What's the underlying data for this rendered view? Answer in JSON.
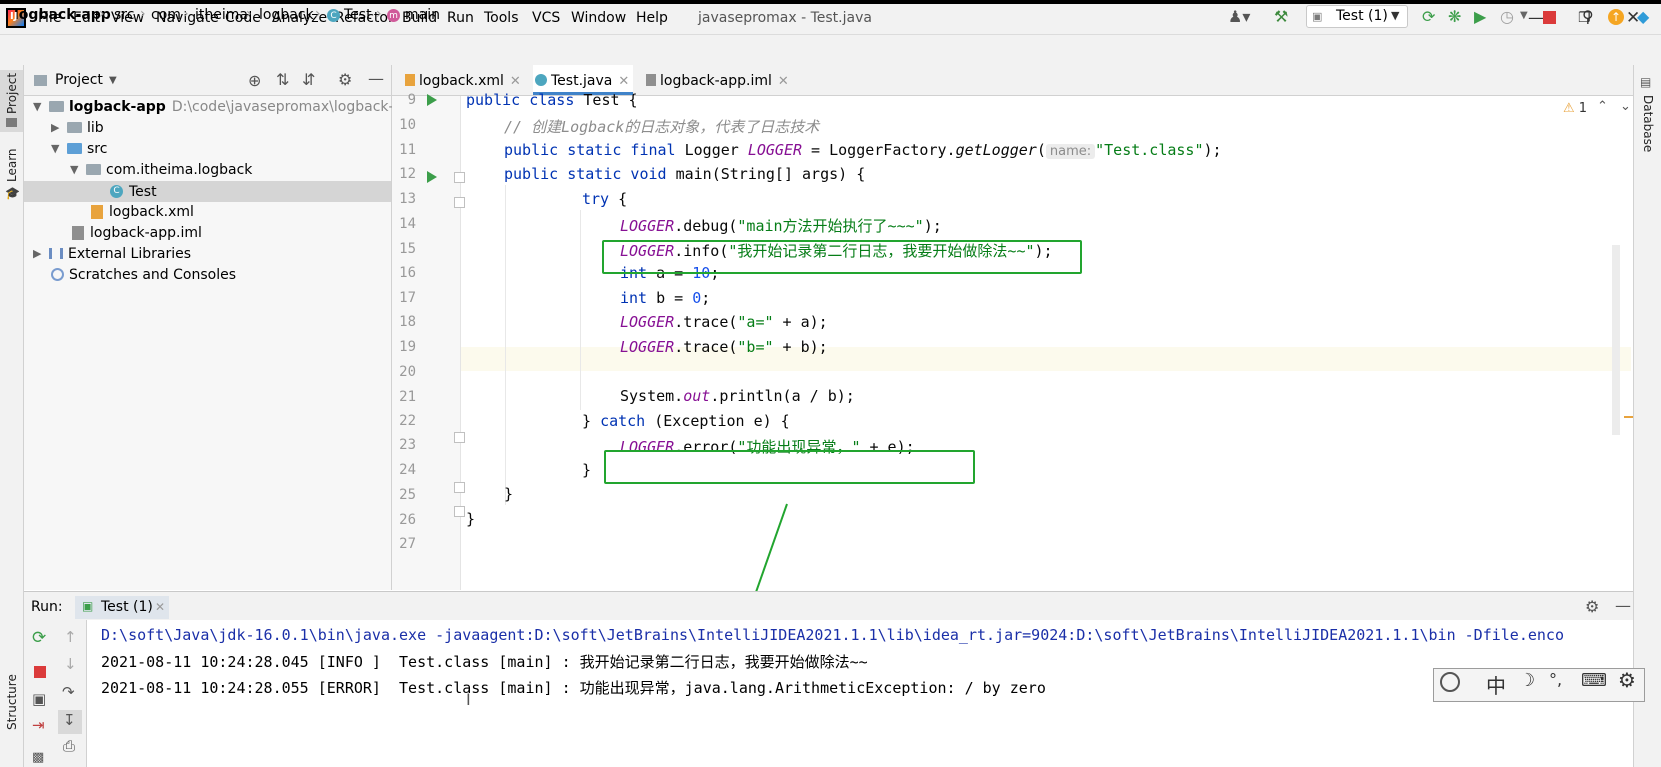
{
  "menubar": {
    "items": [
      "File",
      "Edit",
      "View",
      "Navigate",
      "Code",
      "Analyze",
      "Refactor",
      "Build",
      "Run",
      "Tools",
      "VCS",
      "Window",
      "Help"
    ],
    "window_title": "javasepromax - Test.java"
  },
  "breadcrumb": {
    "project": "logback-app",
    "parts": [
      "src",
      "com",
      "itheima",
      "logback",
      "Test",
      "main"
    ]
  },
  "toolbar": {
    "run_config": "Test (1)"
  },
  "project_panel": {
    "title": "Project",
    "root_name": "logback-app",
    "root_path": "D:\\code\\javasepromax\\logback-app",
    "items": [
      "lib",
      "src",
      "com.itheima.logback",
      "Test",
      "logback.xml",
      "logback-app.iml",
      "External Libraries",
      "Scratches and Consoles"
    ]
  },
  "side_labels": {
    "project": "Project",
    "learn": "Learn",
    "structure": "Structure",
    "database": "Database"
  },
  "editor": {
    "tabs": [
      "logback.xml",
      "Test.java",
      "logback-app.iml"
    ],
    "warning_count": "1",
    "line_numbers": [
      "9",
      "10",
      "11",
      "12",
      "13",
      "14",
      "15",
      "16",
      "17",
      "18",
      "19",
      "20",
      "21",
      "22",
      "23",
      "24",
      "25",
      "26",
      "27"
    ],
    "param_hint": "name:"
  },
  "code": {
    "l9_a": "public class ",
    "l9_b": "Test {",
    "l10": "// 创建Logback的日志对象，代表了日志技术",
    "l11_a": "public static final ",
    "l11_b": "Logger ",
    "l11_c": "LOGGER",
    "l11_d": " = LoggerFactory.",
    "l11_e": "getLogger",
    "l11_f": "(",
    "l11_g": "\"Test.class\"",
    "l11_h": ");",
    "l12_a": "public static void ",
    "l12_b": "main(String[] args) {",
    "l13_a": "try",
    "l13_b": " {",
    "l14_a": "LOGGER",
    "l14_b": ".debug(",
    "l14_c": "\"main方法开始执行了~~~\"",
    "l14_d": ");",
    "l15_a": "LOGGER",
    "l15_b": ".info(",
    "l15_c": "\"我开始记录第二行日志，我要开始做除法~~\"",
    "l15_d": ");",
    "l16_a": "int",
    "l16_b": " a = ",
    "l16_c": "10",
    "l16_d": ";",
    "l17_a": "int",
    "l17_b": " b = ",
    "l17_c": "0",
    "l17_d": ";",
    "l18_a": "LOGGER",
    "l18_b": ".trace(",
    "l18_c": "\"a=\"",
    "l18_d": " + a);",
    "l19_a": "LOGGER",
    "l19_b": ".trace(",
    "l19_c": "\"b=\"",
    "l19_d": " + b);",
    "l21_a": "System.",
    "l21_b": "out",
    "l21_c": ".println(a / b);",
    "l22_a": "} ",
    "l22_b": "catch",
    "l22_c": " (Exception e) {",
    "l23_a": "LOGGER",
    "l23_b": ".error(",
    "l23_c": "\"功能出现异常，\"",
    "l23_d": " + e);",
    "l24": "}",
    "l25": "}",
    "l26": "}"
  },
  "run_panel": {
    "label": "Run:",
    "tab": "Test (1)",
    "console": [
      "D:\\soft\\Java\\jdk-16.0.1\\bin\\java.exe -javaagent:D:\\soft\\JetBrains\\IntelliJIDEA2021.1.1\\lib\\idea_rt.jar=9024:D:\\soft\\JetBrains\\IntelliJIDEA2021.1.1\\bin -Dfile.enco",
      "2021-08-11 10:24:28.045 [INFO ]  Test.class [main] : 我开始记录第二行日志，我要开始做除法~~",
      "2021-08-11 10:24:28.055 [ERROR]  Test.class [main] : 功能出现异常，java.lang.ArithmeticException: / by zero"
    ]
  },
  "ime_bar": {
    "lang": "中"
  },
  "colors": {
    "accent": "#4083c9",
    "highlight_box": "#22a52f",
    "keyword": "#0033b3",
    "string": "#067d17",
    "field": "#871094",
    "stop": "#db3b3b"
  }
}
